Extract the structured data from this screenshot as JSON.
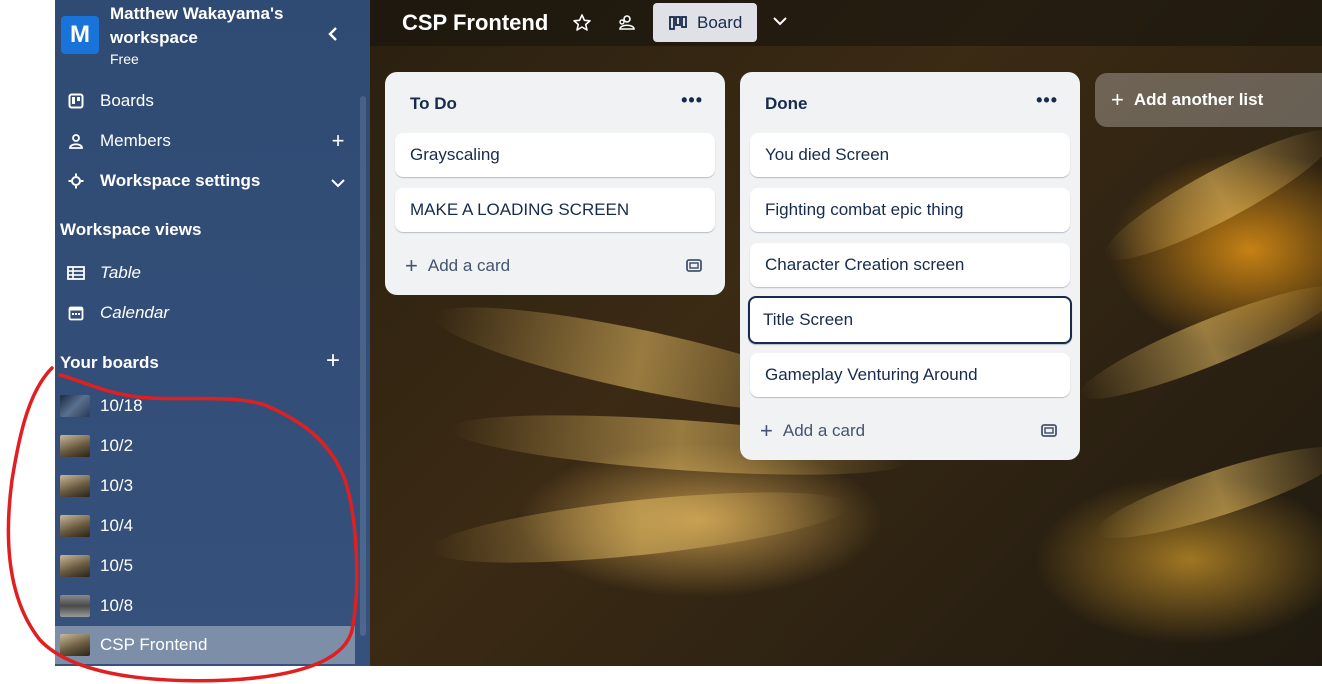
{
  "workspace": {
    "initial": "M",
    "name": "Matthew Wakayama's workspace",
    "plan": "Free"
  },
  "sidebar": {
    "nav": [
      {
        "label": "Boards"
      },
      {
        "label": "Members"
      },
      {
        "label": "Workspace settings"
      }
    ],
    "views_title": "Workspace views",
    "views": [
      {
        "label": "Table"
      },
      {
        "label": "Calendar"
      }
    ],
    "boards_title": "Your boards",
    "boards": [
      {
        "label": "10/18"
      },
      {
        "label": "10/2"
      },
      {
        "label": "10/3"
      },
      {
        "label": "10/4"
      },
      {
        "label": "10/5"
      },
      {
        "label": "10/8"
      },
      {
        "label": "CSP Frontend"
      }
    ]
  },
  "board": {
    "title": "CSP Frontend",
    "view_label": "Board"
  },
  "lists": [
    {
      "title": "To Do",
      "cards": [
        "Grayscaling",
        "MAKE A LOADING SCREEN"
      ],
      "add_card": "Add a card"
    },
    {
      "title": "Done",
      "cards": [
        "You died Screen",
        "Fighting combat epic thing",
        "Character Creation screen",
        "Title Screen",
        "Gameplay Venturing Around"
      ],
      "add_card": "Add a card"
    }
  ],
  "add_list_label": "Add another list",
  "colors": {
    "sidebar": "#2f4b73",
    "accent": "#1a73d8",
    "annotation": "#e02020"
  }
}
